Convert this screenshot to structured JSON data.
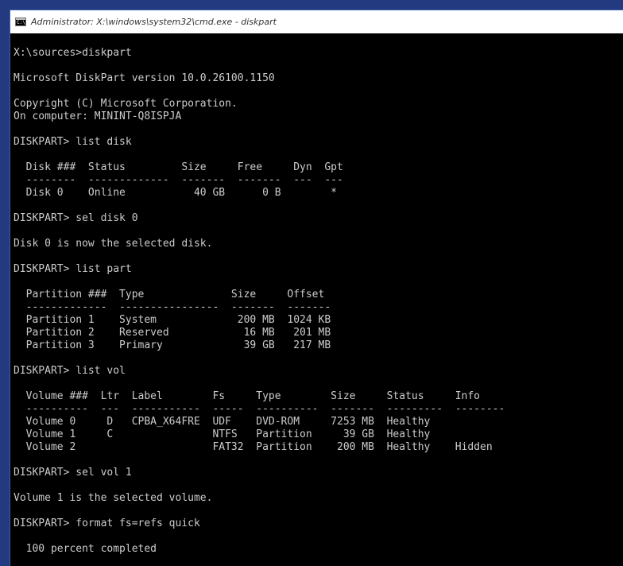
{
  "window": {
    "title": "Administrator: X:\\windows\\system32\\cmd.exe - diskpart"
  },
  "colors": {
    "console_bg": "#000000",
    "console_fg": "#cccccc",
    "titlebar_bg": "#ffffff",
    "desktop_bg": "#243a80"
  },
  "console": {
    "lines": [
      "X:\\sources>diskpart",
      "",
      "Microsoft DiskPart version 10.0.26100.1150",
      "",
      "Copyright (C) Microsoft Corporation.",
      "On computer: MININT-Q8ISPJA",
      "",
      "DISKPART> list disk",
      "",
      "  Disk ###  Status         Size     Free     Dyn  Gpt",
      "  --------  -------------  -------  -------  ---  ---",
      "  Disk 0    Online           40 GB      0 B        *",
      "",
      "DISKPART> sel disk 0",
      "",
      "Disk 0 is now the selected disk.",
      "",
      "DISKPART> list part",
      "",
      "  Partition ###  Type              Size     Offset",
      "  -------------  ----------------  -------  -------",
      "  Partition 1    System             200 MB  1024 KB",
      "  Partition 2    Reserved            16 MB   201 MB",
      "  Partition 3    Primary             39 GB   217 MB",
      "",
      "DISKPART> list vol",
      "",
      "  Volume ###  Ltr  Label        Fs     Type        Size     Status     Info",
      "  ----------  ---  -----------  -----  ----------  -------  ---------  --------",
      "  Volume 0     D   CPBA_X64FRE  UDF    DVD-ROM     7253 MB  Healthy",
      "  Volume 1     C                NTFS   Partition     39 GB  Healthy",
      "  Volume 2                      FAT32  Partition    200 MB  Healthy    Hidden",
      "",
      "DISKPART> sel vol 1",
      "",
      "Volume 1 is the selected volume.",
      "",
      "DISKPART> format fs=refs quick",
      "",
      "  100 percent completed"
    ]
  }
}
